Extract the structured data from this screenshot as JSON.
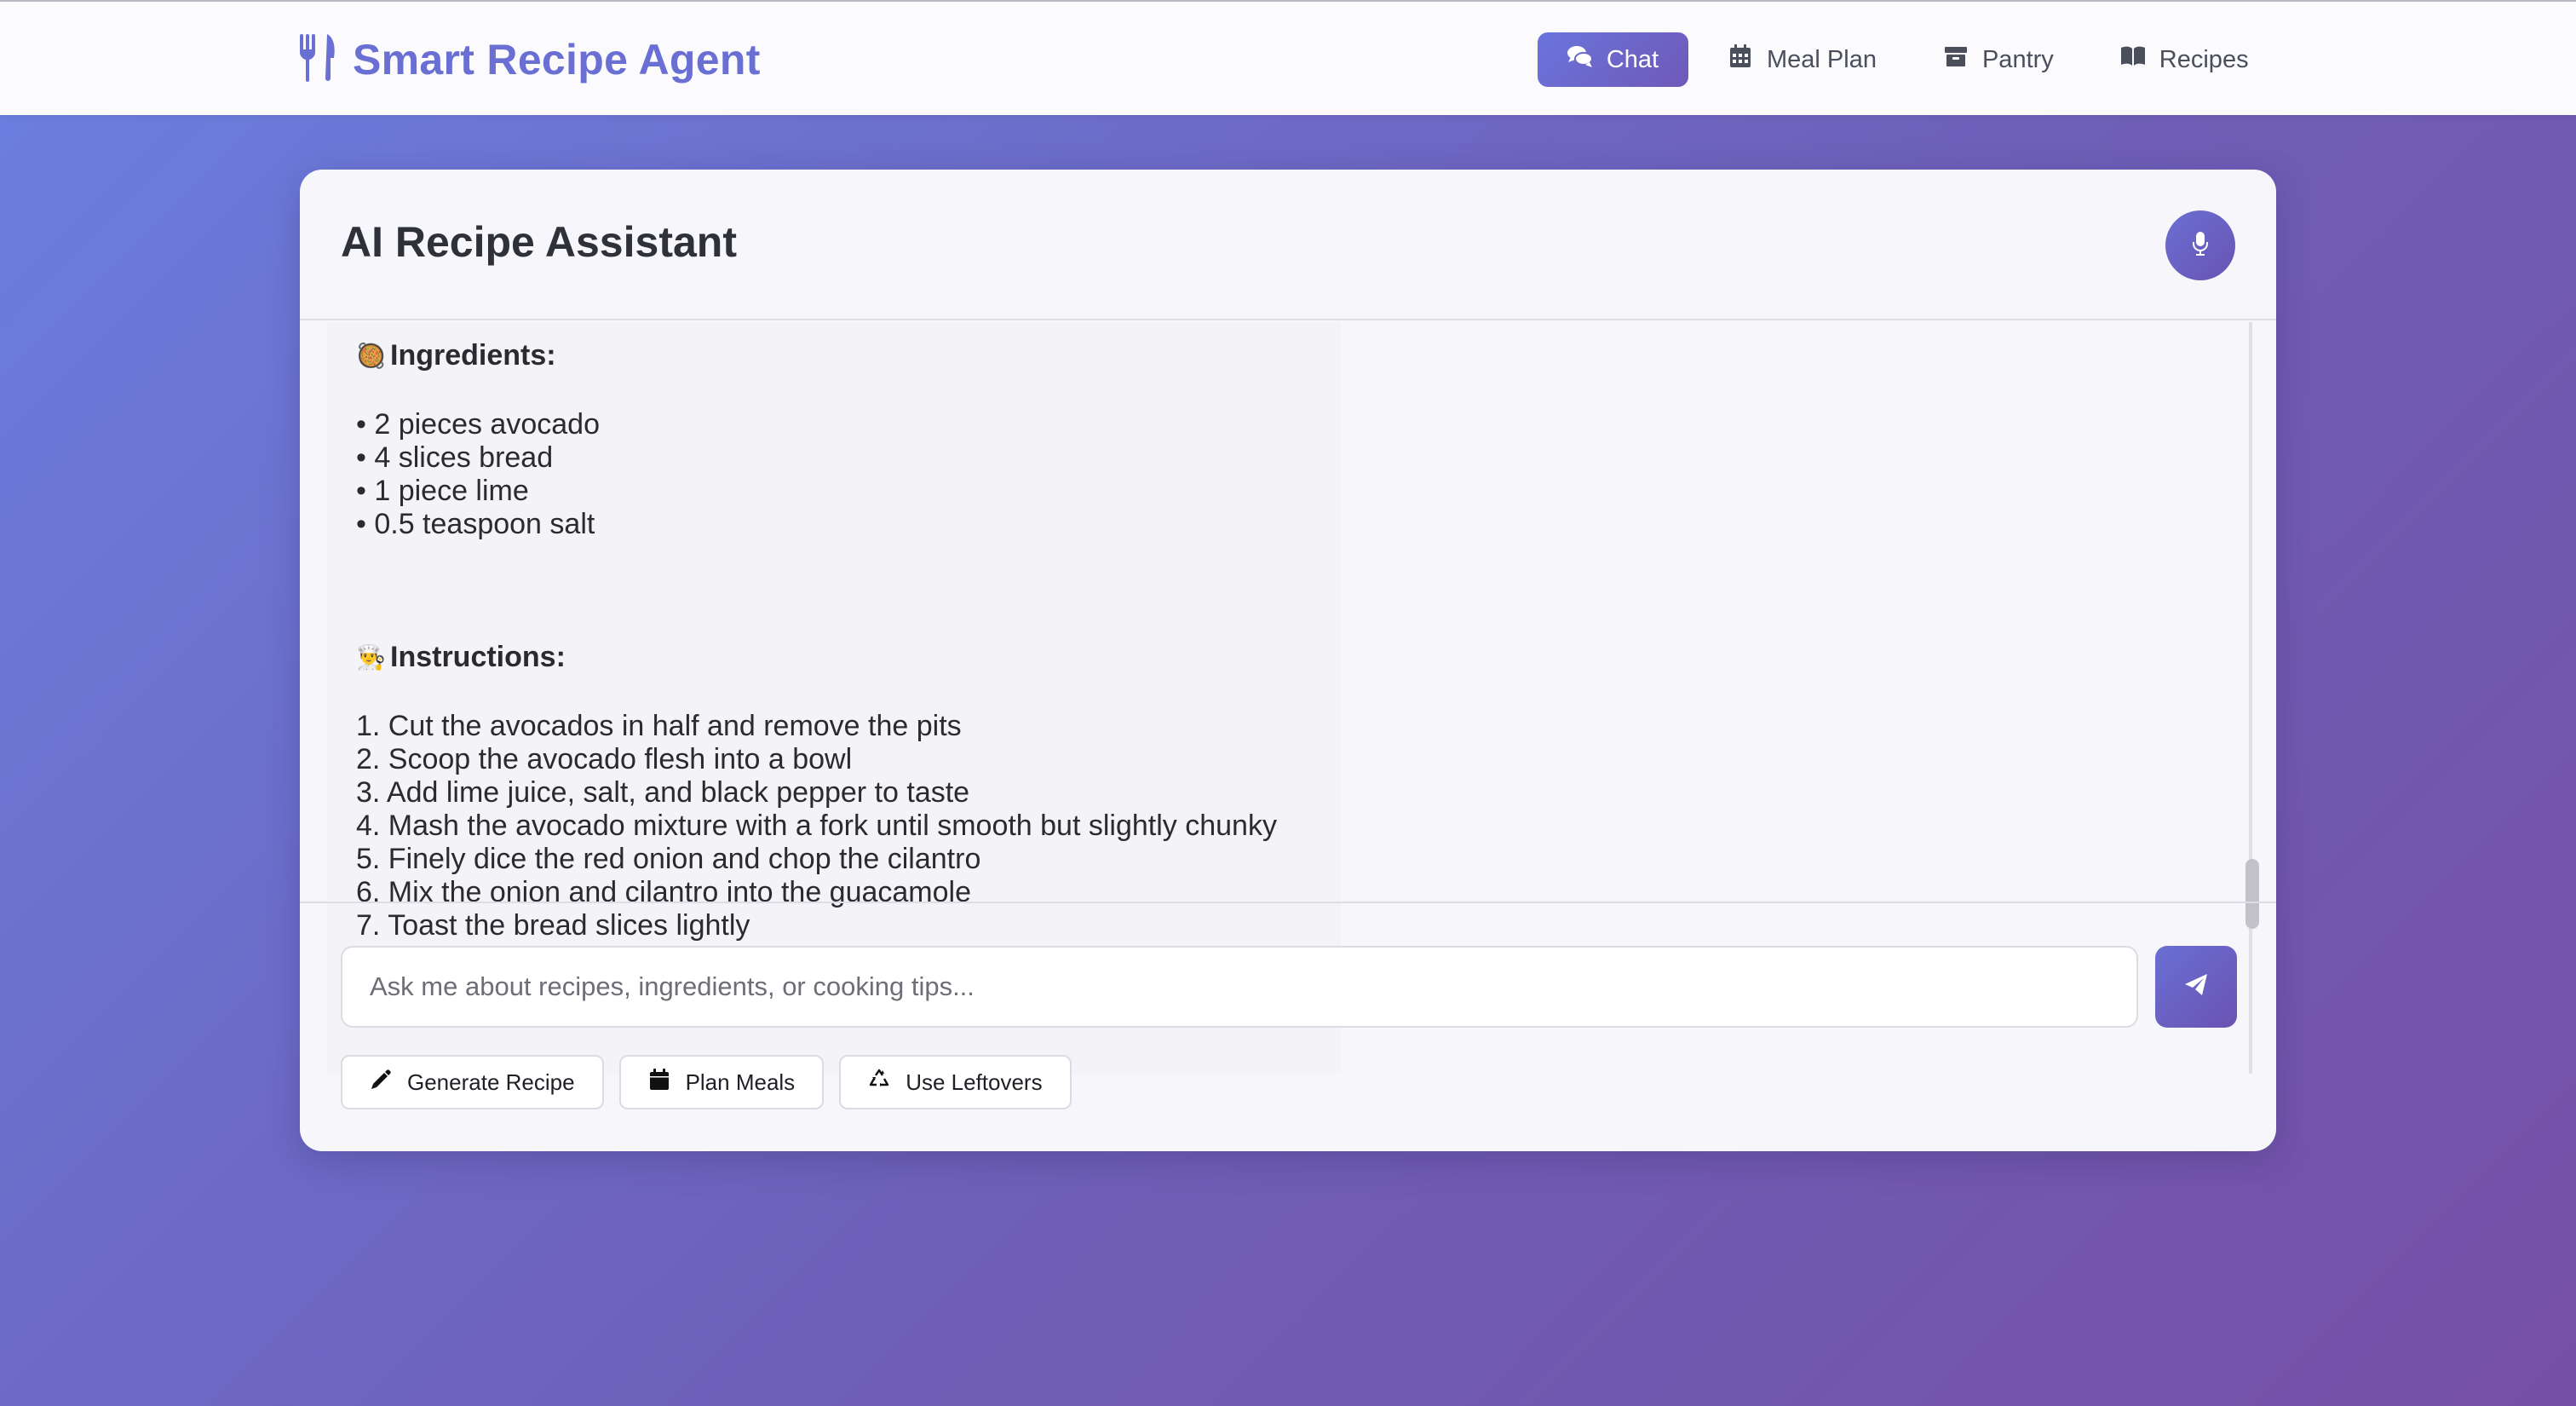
{
  "app": {
    "title": "Smart Recipe Agent",
    "brand_icon": "utensils-icon"
  },
  "nav": {
    "items": [
      {
        "label": "Chat",
        "icon": "comments-icon",
        "active": true
      },
      {
        "label": "Meal Plan",
        "icon": "calendar-icon",
        "active": false
      },
      {
        "label": "Pantry",
        "icon": "archive-box-icon",
        "active": false
      },
      {
        "label": "Recipes",
        "icon": "book-icon",
        "active": false
      }
    ]
  },
  "assistant": {
    "title": "AI Recipe Assistant",
    "mic_icon": "microphone-icon"
  },
  "message": {
    "ingredients_heading": "Ingredients:",
    "ingredients_emoji": "🥘",
    "ingredients": [
      "• 2 pieces avocado",
      "• 4 slices bread",
      "• 1 piece lime",
      "• 0.5 teaspoon salt"
    ],
    "instructions_heading": "Instructions:",
    "instructions_emoji": "👨‍🍳",
    "instructions": [
      "1. Cut the avocados in half and remove the pits",
      "2. Scoop the avocado flesh into a bowl",
      "3. Add lime juice, salt, and black pepper to taste",
      "4. Mash the avocado mixture with a fork until smooth but slightly chunky",
      "5. Finely dice the red onion and chop the cilantro",
      "6. Mix the onion and cilantro into the guacamole",
      "7. Toast the bread slices lightly"
    ]
  },
  "chat_input": {
    "placeholder": "Ask me about recipes, ingredients, or cooking tips...",
    "value": ""
  },
  "quick_actions": [
    {
      "label": "Generate Recipe",
      "icon": "pencil-icon"
    },
    {
      "label": "Plan Meals",
      "icon": "calendar-icon"
    },
    {
      "label": "Use Leftovers",
      "icon": "recycle-icon"
    }
  ],
  "colors": {
    "accent": "#6a6fd4",
    "accent_dark": "#6a53b2",
    "background_start": "#6b7fe0",
    "background_end": "#7650a6"
  }
}
